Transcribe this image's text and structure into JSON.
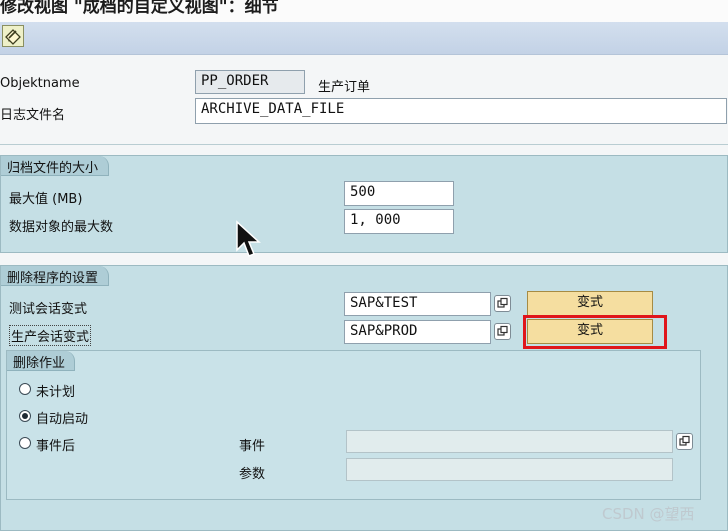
{
  "window": {
    "title": "修改视图 \"成档的自定义视图\"：细节"
  },
  "toolbar": {
    "display_change_icon": "display-change-icon"
  },
  "header": {
    "objektname_label": "Objektname",
    "objektname_value": "PP_ORDER",
    "objektname_desc": "生产订单",
    "logfile_label": "日志文件名",
    "logfile_value": "ARCHIVE_DATA_FILE"
  },
  "archive_size": {
    "title": "归档文件的大小",
    "max_mb_label": "最大值 (MB)",
    "max_mb_value": "500",
    "max_objects_label": "数据对象的最大数",
    "max_objects_value": "1, 000"
  },
  "delete_settings": {
    "title": "删除程序的设置",
    "test_variant_label": "测试会话变式",
    "test_variant_value": "SAP&TEST",
    "test_variant_button": "变式",
    "prod_variant_label": "生产会话变式",
    "prod_variant_value": "SAP&PROD",
    "prod_variant_button": "变式",
    "highlight_color": "#e0151b"
  },
  "delete_job": {
    "title": "删除作业",
    "options": [
      {
        "label": "未计划",
        "selected": false
      },
      {
        "label": "自动启动",
        "selected": true
      },
      {
        "label": "事件后",
        "selected": false
      }
    ],
    "event_label": "事件",
    "event_value": "",
    "param_label": "参数",
    "param_value": ""
  },
  "watermark": "CSDN @望西",
  "colors": {
    "group_bg": "#c5dfe5",
    "group_header": "#aecdd6",
    "button_bg": "#f5dea0",
    "toolbar_bg": "#c9d7ea"
  }
}
